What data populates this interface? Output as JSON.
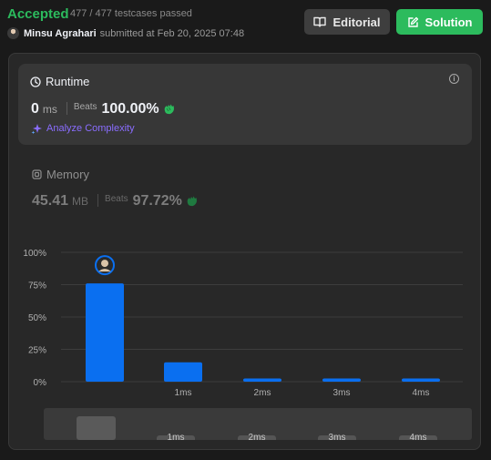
{
  "header": {
    "status": "Accepted",
    "testcases": "477 / 477 testcases passed",
    "username": "Minsu Agrahari",
    "submitted_text": "submitted at Feb 20, 2025 07:48",
    "editorial_label": "Editorial",
    "solution_label": "Solution"
  },
  "runtime": {
    "title": "Runtime",
    "value": "0",
    "unit": "ms",
    "beats_label": "Beats",
    "beats_value": "100.00%",
    "analyze_label": "Analyze Complexity"
  },
  "memory": {
    "title": "Memory",
    "value": "45.41",
    "unit": "MB",
    "beats_label": "Beats",
    "beats_value": "97.72%"
  },
  "colors": {
    "accepted": "#2cbb5d",
    "bar": "#0a6ff0",
    "accent_purple": "#8a6dff"
  },
  "chart_data": {
    "type": "bar",
    "categories": [
      "",
      "1ms",
      "2ms",
      "3ms",
      "4ms"
    ],
    "values": [
      76,
      15,
      2.5,
      2.5,
      2.5
    ],
    "ylim": [
      0,
      100
    ],
    "yticks": [
      "100%",
      "75%",
      "50%",
      "25%",
      "0%"
    ],
    "ytick_values": [
      100,
      75,
      50,
      25,
      0
    ],
    "xlabel": "",
    "ylabel": "",
    "grid": true,
    "highlight_index": 0
  },
  "minimap": {
    "labels": [
      "1ms",
      "2ms",
      "3ms",
      "4ms"
    ]
  }
}
